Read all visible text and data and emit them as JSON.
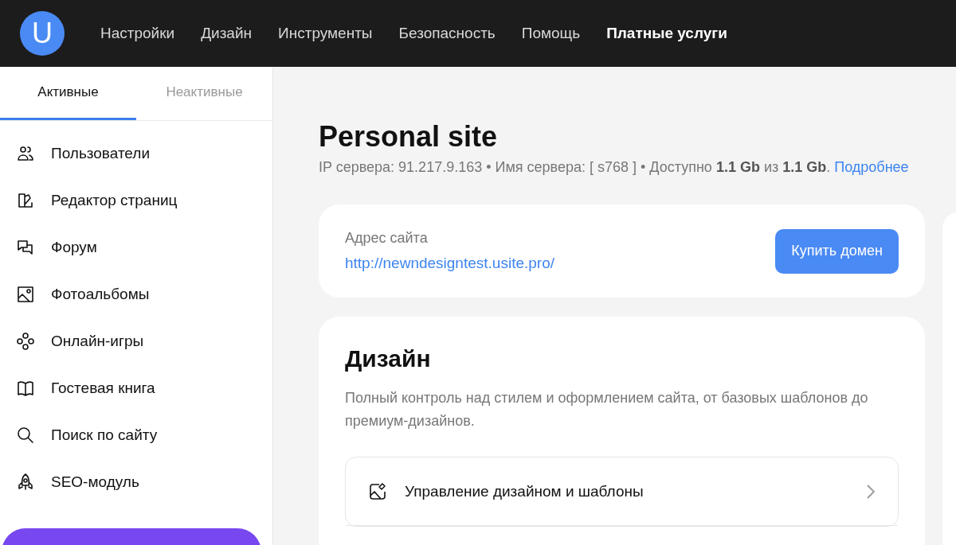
{
  "header": {
    "logo": "U",
    "nav": [
      {
        "label": "Настройки",
        "selected": false
      },
      {
        "label": "Дизайн",
        "selected": false
      },
      {
        "label": "Инструменты",
        "selected": false
      },
      {
        "label": "Безопасность",
        "selected": false
      },
      {
        "label": "Помощь",
        "selected": false
      },
      {
        "label": "Платные услуги",
        "selected": true
      }
    ]
  },
  "sidebar": {
    "tabs": [
      {
        "label": "Активные",
        "selected": true
      },
      {
        "label": "Неактивные",
        "selected": false
      }
    ],
    "items": [
      {
        "label": "Пользователи"
      },
      {
        "label": "Редактор страниц"
      },
      {
        "label": "Форум"
      },
      {
        "label": "Фотоальбомы"
      },
      {
        "label": "Онлайн-игры"
      },
      {
        "label": "Гостевая книга"
      },
      {
        "label": "Поиск по сайту"
      },
      {
        "label": "SEO-модуль"
      }
    ]
  },
  "site": {
    "title": "Personal site",
    "info": "IP сервера: 91.217.9.163 • Имя сервера: [ s768 ] • Доступно **1.1 Gb** из **1.1 Gb**.",
    "info_link": "Подробнее"
  },
  "address_card": {
    "label": "Адрес сайта",
    "url": "http://newndesigntest.usite.pro/",
    "button": "Купить домен"
  },
  "design_card": {
    "title": "Дизайн",
    "description": "Полный контроль над стилем и оформлением сайта, от базовых шаблонов до премиум-дизайнов.",
    "links": [
      {
        "label": "Управление дизайном и шаблоны"
      }
    ]
  }
}
